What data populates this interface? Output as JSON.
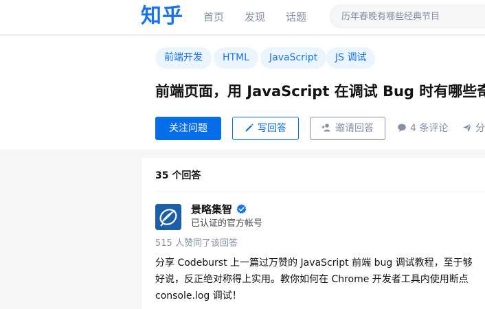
{
  "header": {
    "logo": "知乎",
    "nav": [
      "首页",
      "发现",
      "话题"
    ],
    "search_placeholder": "历年春晚有哪些经典节目"
  },
  "question": {
    "tags": [
      "前端开发",
      "HTML",
      "JavaScript",
      "JS 调试"
    ],
    "title": "前端页面，用 JavaScript 在调试 Bug 时有哪些奇",
    "follow_label": "关注问题",
    "write_label": "写回答",
    "invite_label": "邀请回答",
    "comments_label": "4 条评论",
    "share_label": "分"
  },
  "answers": {
    "count_label": "35 个回答",
    "first": {
      "author_name": "景略集智",
      "author_headline": "已认证的官方帐号",
      "votes_label": "515 人赞同了该回答",
      "lines": [
        "分享 Codeburst 上一篇过万赞的 JavaScript 前端 bug 调试教程，至于够",
        "好说，反正绝对称得上实用。教你如何在 Chrome 开发者工具内使用断点",
        "console.log 调试！"
      ]
    }
  },
  "colors": {
    "brand": "#1772f6",
    "primary_button": "#056de8",
    "tag_bg": "#ebf5ff",
    "muted": "#8590a6"
  }
}
